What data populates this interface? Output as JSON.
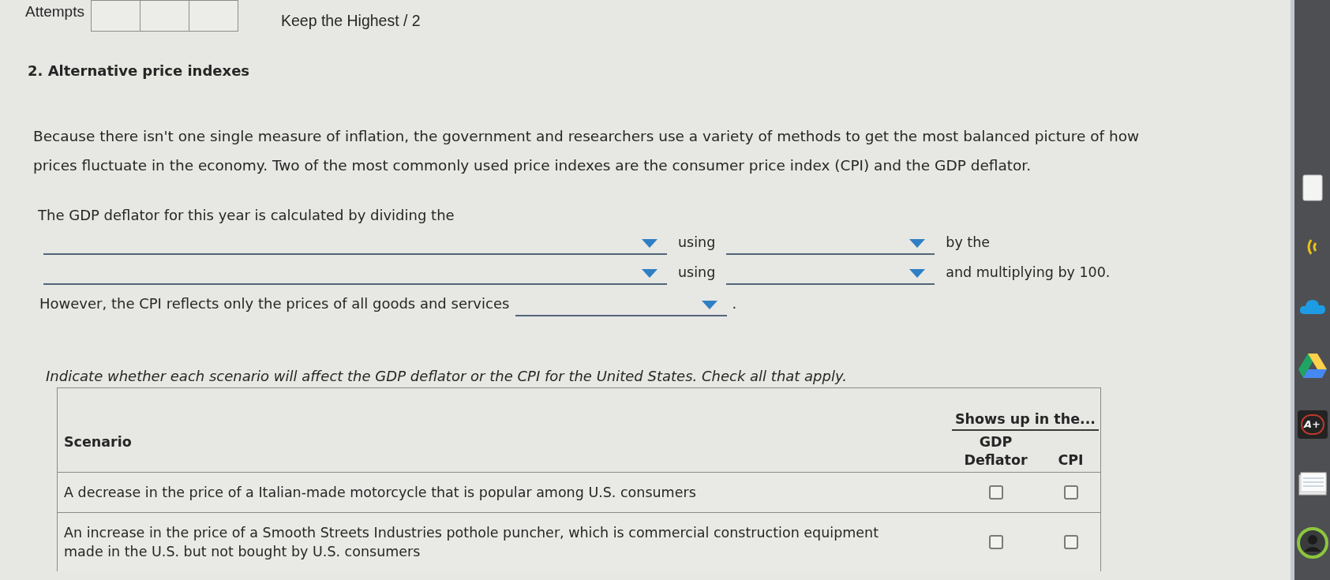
{
  "header": {
    "attempts_label": "Attempts",
    "attempt_slots": [
      {
        "used": false
      },
      {
        "used": false
      },
      {
        "used": false
      }
    ],
    "score_rule": "Keep the Highest / 2"
  },
  "question": {
    "title": "2. Alternative price indexes",
    "intro": "Because there isn't one single measure of inflation, the government and researchers use a variety of methods to get the most balanced picture of how prices fluctuate in the economy. Two of the most commonly used price indexes are the consumer price index (CPI) and the GDP deflator.",
    "gdp_deflator_sentence": {
      "lead": "The GDP deflator for this year is calculated by dividing the",
      "lines": [
        [
          {
            "kind": "dropdown"
          },
          {
            "kind": "text",
            "text": "using"
          },
          {
            "kind": "dropdown"
          },
          {
            "kind": "text",
            "text": "by the"
          }
        ],
        [
          {
            "kind": "dropdown"
          },
          {
            "kind": "text",
            "text": "using"
          },
          {
            "kind": "dropdown"
          },
          {
            "kind": "text",
            "text": "and multiplying by 100."
          }
        ]
      ]
    },
    "cpi_sentence": [
      {
        "kind": "text",
        "text": "However, the CPI reflects only the prices of all goods and services"
      },
      {
        "kind": "dropdown"
      },
      {
        "kind": "text",
        "text": "."
      }
    ],
    "instruction": "Indicate whether each scenario will affect the GDP deflator or the CPI for the United States. Check all that apply.",
    "table": {
      "scenario_column": "Scenario",
      "group_heading": "Shows up in the...",
      "check_columns": [
        "GDP Deflator",
        "CPI"
      ],
      "rows": [
        {
          "scenario": "A decrease in the price of a Italian-made motorcycle that is popular among U.S. consumers",
          "checks": [
            {
              "checked": false
            },
            {
              "checked": false
            }
          ]
        },
        {
          "scenario": "An increase in the price of a Smooth Streets Industries pothole puncher, which is commercial construction equipment made in the U.S. but not bought by U.S. consumers",
          "checks": [
            {
              "checked": false
            },
            {
              "checked": false
            }
          ]
        }
      ]
    }
  },
  "shelf": {
    "grade_app_label": "A+"
  }
}
